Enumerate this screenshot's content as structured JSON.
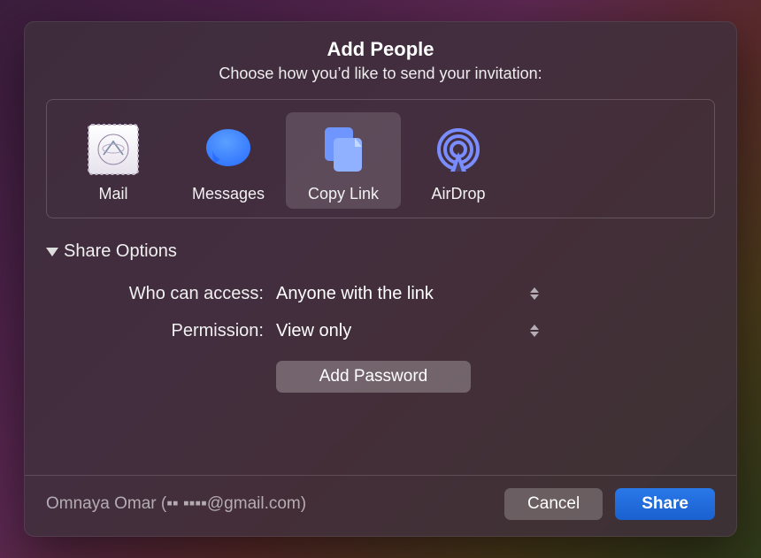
{
  "title": "Add People",
  "subtitle": "Choose how you’d like to send your invitation:",
  "methods": [
    {
      "id": "mail",
      "label": "Mail",
      "icon": "mail-stamp-icon",
      "selected": false
    },
    {
      "id": "messages",
      "label": "Messages",
      "icon": "messages-icon",
      "selected": false
    },
    {
      "id": "copylink",
      "label": "Copy Link",
      "icon": "copy-link-icon",
      "selected": true
    },
    {
      "id": "airdrop",
      "label": "AirDrop",
      "icon": "airdrop-icon",
      "selected": false
    }
  ],
  "shareOptions": {
    "disclosure_label": "Share Options",
    "who_label": "Who can access:",
    "who_value": "Anyone with the link",
    "permission_label": "Permission:",
    "permission_value": "View only",
    "add_password_label": "Add Password"
  },
  "footer": {
    "account_text": "Omnaya Omar (▪▪ ▪▪▪▪@gmail.com)",
    "cancel_label": "Cancel",
    "share_label": "Share"
  }
}
